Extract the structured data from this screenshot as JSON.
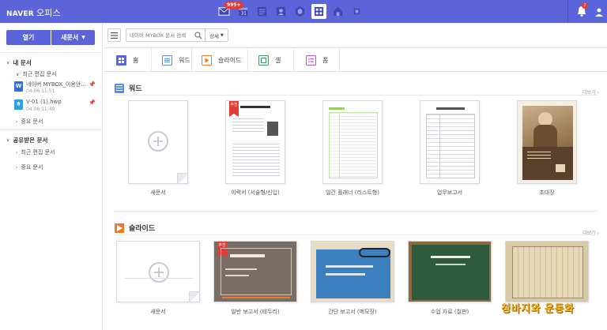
{
  "header": {
    "brand": "NAVER",
    "app_name": "오피스",
    "mail_badge": "999+",
    "notif_badge": "2",
    "apps": [
      "mail-icon",
      "calendar-icon",
      "memo-icon",
      "contacts-icon",
      "cloud-icon",
      "office-icon",
      "home-icon",
      "more-icon"
    ]
  },
  "sidebar": {
    "open_label": "열기",
    "new_label": "새문서",
    "my_docs": "내 문서",
    "recent": "최근 편집 문서",
    "files": [
      {
        "name": "네이버 MYBOX_이용안...",
        "date": "04.06 11:51",
        "type": "W"
      },
      {
        "name": "V-01 (1).hwp",
        "date": "04.06 11:49",
        "type": "ㅎ"
      }
    ],
    "important": "중요 문서",
    "shared_docs": "공유받은 문서",
    "shared_recent": "최근 편집 문서",
    "shared_important": "중요 문서"
  },
  "toolbar": {
    "search_placeholder": "네이버 MYBOX 문서 검색",
    "detail_label": "상세"
  },
  "tabs": [
    {
      "label": "홈",
      "color": "#5b64d8"
    },
    {
      "label": "워드",
      "color": "#5b8ee8"
    },
    {
      "label": "슬라이드",
      "color": "#f07a2c"
    },
    {
      "label": "셀",
      "color": "#27a55a"
    },
    {
      "label": "폼",
      "color": "#b453d2"
    }
  ],
  "word_section": {
    "title": "워드",
    "more": "더보기",
    "templates": [
      {
        "label": "새문서"
      },
      {
        "label": "이력서 (서술형/신입)",
        "ribbon": "추천"
      },
      {
        "label": "일간 플래너 (리스트형)"
      },
      {
        "label": "업무보고서"
      },
      {
        "label": "초대장"
      }
    ]
  },
  "slide_section": {
    "title": "슬라이드",
    "more": "더보기",
    "templates": [
      {
        "label": "새문서"
      },
      {
        "label": "일반 보고서 (테두리)",
        "ribbon": "추천"
      },
      {
        "label": "간단 보고서 (메모장)"
      },
      {
        "label": "수업 자료 (칠판)"
      },
      {
        "label": ""
      }
    ]
  },
  "watermark": "청바지와 운동화"
}
